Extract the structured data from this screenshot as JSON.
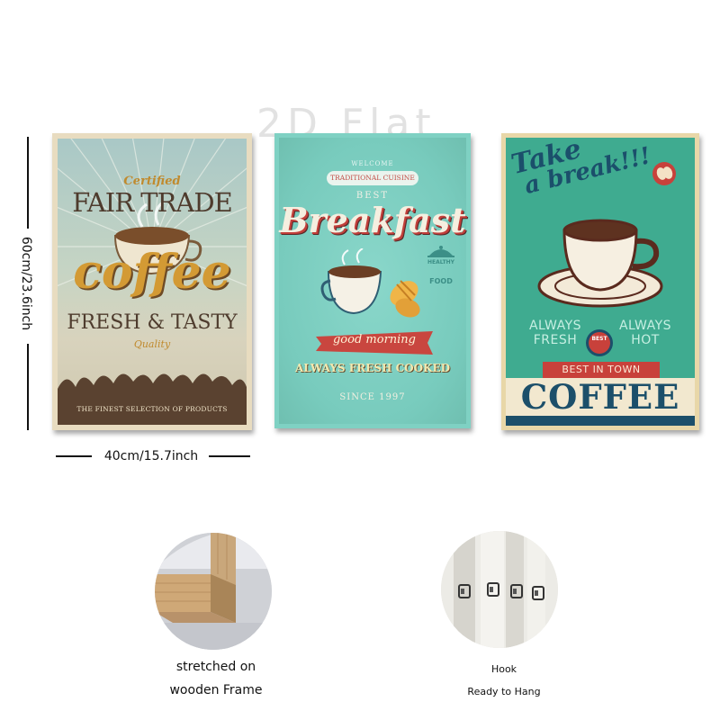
{
  "watermark": "2D Flat",
  "dimensions": {
    "height_label": "60cm/23.6inch",
    "width_label": "40cm/15.7inch"
  },
  "posters": [
    {
      "certified": "Certified",
      "fair_trade": "FAIR TRADE",
      "coffee": "coffee",
      "fresh_tasty": "FRESH & TASTY",
      "quality": "Quality",
      "finest": "THE FINEST SELECTION OF PRODUCTS"
    },
    {
      "welcome": "WELCOME",
      "traditional": "TRADITIONAL CUISINE",
      "best": "BEST",
      "breakfast": "Breakfast",
      "healthy": "HEALTHY",
      "food": "FOOD",
      "good_morning": "good morning",
      "always_fresh_cooked": "ALWAYS FRESH COOKED",
      "since": "SINCE 1997"
    },
    {
      "take": "Take",
      "a_break": "a break!!!",
      "always_fresh": "ALWAYS FRESH",
      "always_hot": "ALWAYS HOT",
      "best_badge": "BEST",
      "best_in_town": "BEST IN TOWN",
      "coffee": "COFFEE"
    }
  ],
  "details": {
    "frame_caption_line1": "stretched on",
    "frame_caption_line2": "wooden Frame",
    "hook_caption_line1": "Hook",
    "hook_caption_line2": "Ready to Hang"
  },
  "colors": {
    "poster2_teal": "#7fd1c3",
    "poster3_green": "#3fab90",
    "poster3_navy": "#1c4f6a",
    "poster3_red": "#c8413b",
    "coffee_gold": "#d39a34"
  }
}
